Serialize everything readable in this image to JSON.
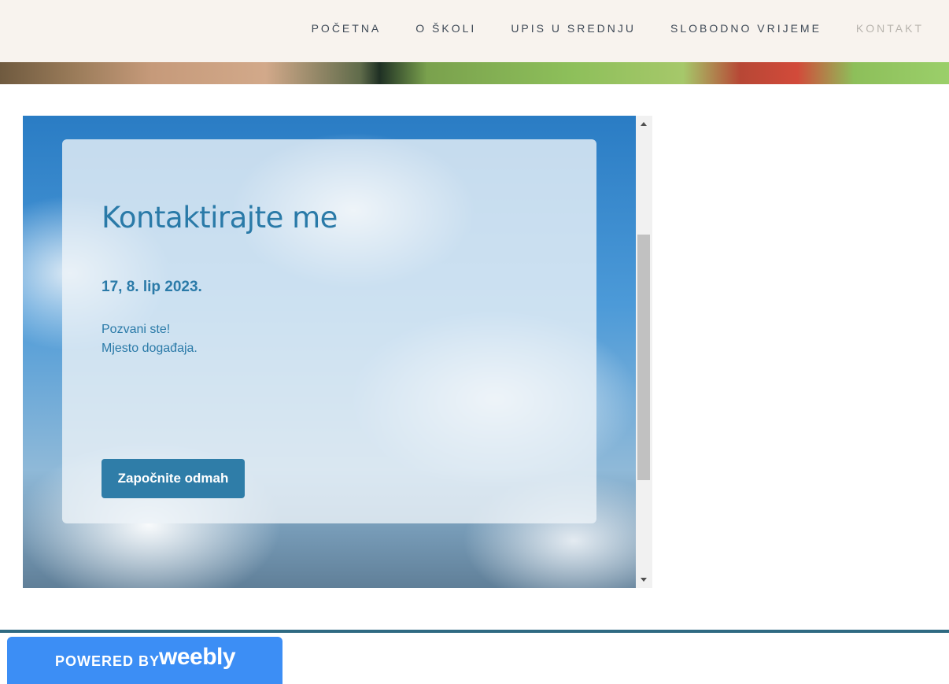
{
  "nav": {
    "items": [
      {
        "label": "POČETNA"
      },
      {
        "label": "O ŠKOLI"
      },
      {
        "label": "UPIS U SREDNJU"
      },
      {
        "label": "SLOBODNO VRIJEME"
      },
      {
        "label": "KONTAKT",
        "active": true
      }
    ]
  },
  "card": {
    "title": "Kontaktirajte me",
    "date": "17, 8. lip 2023.",
    "body_line1": "Pozvani ste!",
    "body_line2": "Mjesto događaja.",
    "button_label": "Započnite odmah"
  },
  "footer": {
    "powered_by": "POWERED BY",
    "brand": "weebly"
  },
  "colors": {
    "header_bg": "#f8f3ee",
    "accent_text": "#2a7aa8",
    "button_bg": "#2f7da8",
    "weebly_blue": "#3c8ef5",
    "footer_line": "#2f6a82"
  }
}
